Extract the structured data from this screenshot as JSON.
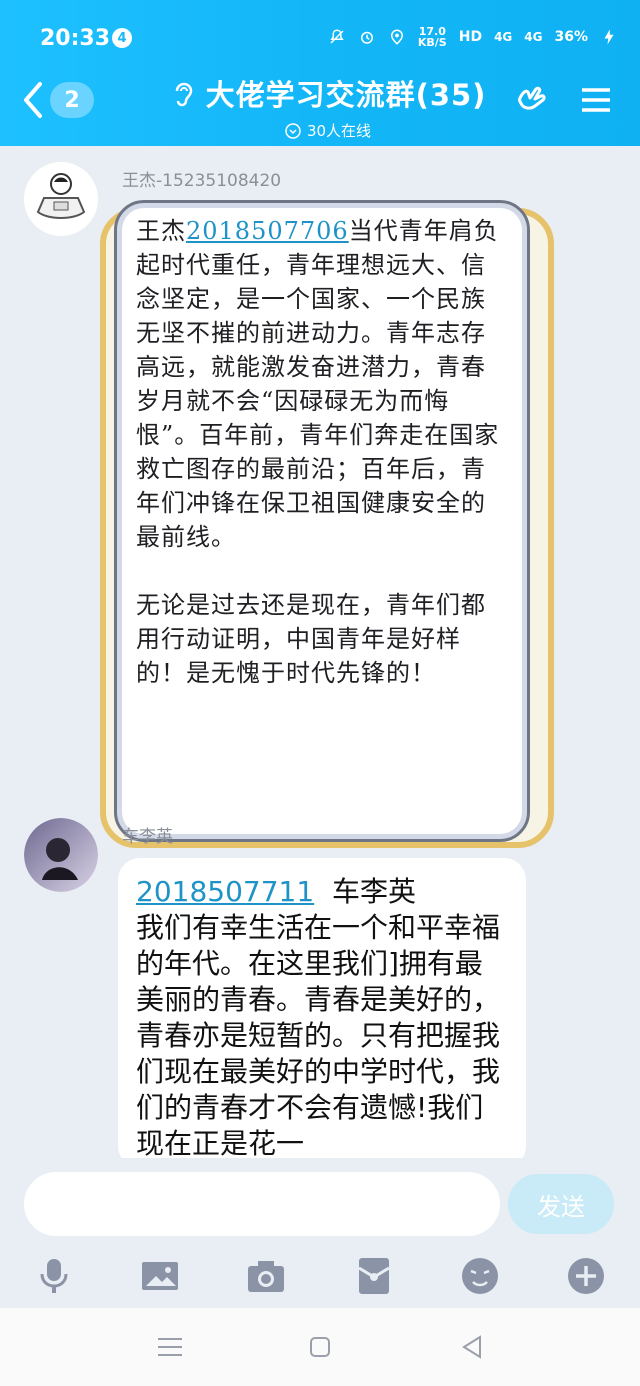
{
  "status": {
    "time": "20:33",
    "notif_count": "4",
    "speed_value": "17.0",
    "speed_unit": "KB/S",
    "hd": "HD",
    "net1": "4G",
    "net2": "4G",
    "battery": "36%"
  },
  "header": {
    "back_count": "2",
    "title": "大佬学习交流群(35)",
    "online": "30人在线"
  },
  "messages": [
    {
      "sender": "王杰-15235108420",
      "id": "2018507706",
      "text": "当代青年肩负起时代重任，青年理想远大、信念坚定，是一个国家、一个民族无坚不摧的前进动力。青年志存高远，就能激发奋进潜力，青春岁月就不会“因碌碌无为而悔恨”。百年前，青年们奔走在国家救亡图存的最前沿；百年后，青年们冲锋在保卫祖国健康安全的最前线。",
      "text2": "无论是过去还是现在，青年们都用行动证明，中国青年是好样的！是无愧于时代先锋的！",
      "name_prefix": "王杰"
    },
    {
      "sender": "车李英",
      "id": "2018507711",
      "name_suffix": "车李英",
      "text": "我们有幸生活在一个和平幸福的年代。在这里我们]拥有最美丽的青春。青春是美好的，青春亦是短暂的。只有把握我们现在最美好的中学时代，我们的青春才不会有遗憾!我们现在正是花一"
    }
  ],
  "composer": {
    "placeholder": "",
    "send_label": "发送"
  },
  "colors": {
    "header_blue": "#13b6f7",
    "link": "#1e93c7",
    "send_bg": "#c8ebf7"
  }
}
